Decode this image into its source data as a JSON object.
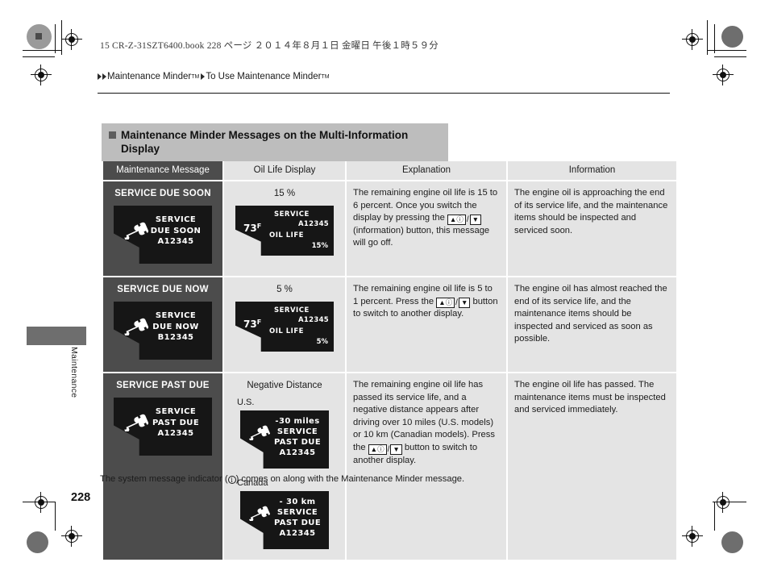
{
  "print_header": {
    "file_line": "15 CR-Z-31SZT6400.book   228 ページ   ２０１４年８月１日   金曜日   午後１時５９分"
  },
  "breadcrumb": {
    "item1": "Maintenance Minder",
    "item1_sup": "TM",
    "item2": "To Use Maintenance Minder",
    "item2_sup": "TM"
  },
  "section": {
    "title_line1": "Maintenance Minder Messages on the Multi-Information",
    "title_line2": "Display"
  },
  "table": {
    "headers": [
      "Maintenance Message",
      "Oil Life Display",
      "Explanation",
      "Information"
    ],
    "rows": [
      {
        "message_label": "SERVICE DUE SOON",
        "lcd_message": {
          "line1": "SERVICE",
          "line2": "DUE SOON",
          "line3": "A12345"
        },
        "oil_heading": "15 %",
        "oil_display": {
          "temp": "73",
          "temp_unit": "F",
          "service_label": "SERVICE",
          "code": "A12345",
          "oil_life_label": "OIL LIFE",
          "value": "15%"
        },
        "explanation_pre": "The remaining engine oil life is 15 to 6 percent. Once you switch the display by pressing the ",
        "explanation_post": " (information) button, this message will go off.",
        "information": "The engine oil is approaching the end of its service life, and the maintenance items should be inspected and serviced soon."
      },
      {
        "message_label": "SERVICE DUE NOW",
        "lcd_message": {
          "line1": "SERVICE",
          "line2": "DUE NOW",
          "line3": "B12345"
        },
        "oil_heading": "5 %",
        "oil_display": {
          "temp": "73",
          "temp_unit": "F",
          "service_label": "SERVICE",
          "code": "A12345",
          "oil_life_label": "OIL LIFE",
          "value": "5%"
        },
        "explanation_pre": "The remaining engine oil life is 5 to 1 percent. Press the ",
        "explanation_post": " button to switch to another display.",
        "information": "The engine oil has almost reached the end of its service life, and the maintenance items should be inspected and serviced as soon as possible."
      },
      {
        "message_label": "SERVICE PAST DUE",
        "lcd_message": {
          "line1": "SERVICE",
          "line2": "PAST DUE",
          "line3": "A12345"
        },
        "oil_heading": "Negative Distance",
        "region_us_label": "U.S.",
        "lcd_us": {
          "line1": "-30 miles",
          "line2": "SERVICE",
          "line3": "PAST DUE",
          "line4": "A12345"
        },
        "region_ca_label": "Canada",
        "lcd_ca": {
          "line1": "- 30 km",
          "line2": "SERVICE",
          "line3": "PAST DUE",
          "line4": "A12345"
        },
        "explanation_pre": "The remaining engine oil life has passed its service life, and a negative distance appears after driving over 10 miles (U.S. models) or 10 km (Canadian models). Press the ",
        "explanation_post": " button to switch to another display.",
        "information": "The engine oil life has passed. The maintenance items must be inspected and serviced immediately."
      }
    ]
  },
  "button_glyph": {
    "up": "▲",
    "info": "ⓘ",
    "separator": "/",
    "down": "▼"
  },
  "footnote": {
    "pre": "The system message indicator (",
    "icon": "i",
    "post": ") comes on along with the Maintenance Minder message."
  },
  "side_tab": {
    "label": "Maintenance"
  },
  "page_number": "228",
  "colors": {
    "dark_cell": "#4c4c4c",
    "light_cell": "#e4e4e4",
    "title_band": "#bdbdbd",
    "lcd_bg": "#161616"
  }
}
